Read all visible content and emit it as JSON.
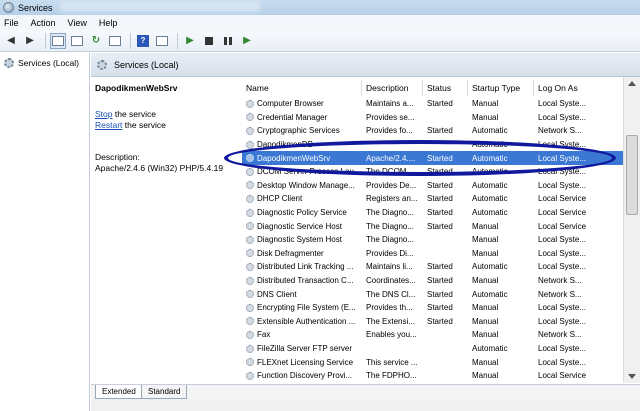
{
  "window": {
    "title": "Services"
  },
  "menu": [
    "File",
    "Action",
    "View",
    "Help"
  ],
  "tree": {
    "root_label": "Services (Local)"
  },
  "pane": {
    "header": "Services (Local)"
  },
  "details": {
    "service_name": "DapodikmenWebSrv",
    "stop_link": "Stop",
    "stop_rest": " the service",
    "restart_link": "Restart",
    "restart_rest": " the service",
    "description_label": "Description:",
    "description_text": "Apache/2.4.6 (Win32) PHP/5.4.19"
  },
  "table": {
    "columns": [
      "Name",
      "Description",
      "Status",
      "Startup Type",
      "Log On As"
    ],
    "rows": [
      [
        "Computer Browser",
        "Maintains a...",
        "Started",
        "Manual",
        "Local Syste..."
      ],
      [
        "Credential Manager",
        "Provides se...",
        "",
        "Manual",
        "Local Syste..."
      ],
      [
        "Cryptographic Services",
        "Provides fo...",
        "Started",
        "Automatic",
        "Network S..."
      ],
      [
        "DapodikmenDB",
        "",
        "",
        "Automatic",
        "Local Syste..."
      ],
      [
        "DapodikmenWebSrv",
        "Apache/2.4....",
        "Started",
        "Automatic",
        "Local Syste..."
      ],
      [
        "DCOM Server Process Lau...",
        "The DCOM...",
        "Started",
        "Automatic",
        "Local Syste..."
      ],
      [
        "Desktop Window Manage...",
        "Provides De...",
        "Started",
        "Automatic",
        "Local Syste..."
      ],
      [
        "DHCP Client",
        "Registers an...",
        "Started",
        "Automatic",
        "Local Service"
      ],
      [
        "Diagnostic Policy Service",
        "The Diagno...",
        "Started",
        "Automatic",
        "Local Service"
      ],
      [
        "Diagnostic Service Host",
        "The Diagno...",
        "Started",
        "Manual",
        "Local Service"
      ],
      [
        "Diagnostic System Host",
        "The Diagno...",
        "",
        "Manual",
        "Local Syste..."
      ],
      [
        "Disk Defragmenter",
        "Provides Di...",
        "",
        "Manual",
        "Local Syste..."
      ],
      [
        "Distributed Link Tracking ...",
        "Maintains li...",
        "Started",
        "Automatic",
        "Local Syste..."
      ],
      [
        "Distributed Transaction C...",
        "Coordinates...",
        "Started",
        "Manual",
        "Network S..."
      ],
      [
        "DNS Client",
        "The DNS Cl...",
        "Started",
        "Automatic",
        "Network S..."
      ],
      [
        "Encrypting File System (E...",
        "Provides th...",
        "Started",
        "Manual",
        "Local Syste..."
      ],
      [
        "Extensible Authentication ...",
        "The Extensi...",
        "Started",
        "Manual",
        "Local Syste..."
      ],
      [
        "Fax",
        "Enables you...",
        "",
        "Manual",
        "Network S..."
      ],
      [
        "FileZilla Server FTP server",
        "",
        "",
        "Automatic",
        "Local Syste..."
      ],
      [
        "FLEXnet Licensing Service",
        "This service ...",
        "",
        "Manual",
        "Local Syste..."
      ],
      [
        "Function Discovery Provi...",
        "The FDPHO...",
        "",
        "Manual",
        "Local Service"
      ]
    ],
    "selected_index": 4
  },
  "tabs": [
    "Extended",
    "Standard"
  ],
  "colors": {
    "selection": "#3a78d4",
    "annotation": "#10199e"
  }
}
